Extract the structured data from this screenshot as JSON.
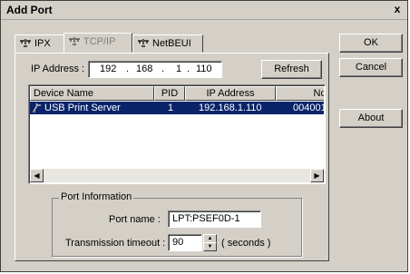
{
  "window": {
    "title": "Add Port",
    "close_glyph": "x"
  },
  "tabs": [
    {
      "label": "IPX",
      "icon": "network-icon"
    },
    {
      "label": "TCP/IP",
      "icon": "network-icon"
    },
    {
      "label": "NetBEUI",
      "icon": "network-icon"
    }
  ],
  "ip": {
    "label": "IP Address :",
    "seg1": "192",
    "seg2": "168",
    "seg3": "1",
    "seg4": "110",
    "dot": "."
  },
  "buttons": {
    "refresh": "Refresh",
    "ok": "OK",
    "cancel": "Cancel",
    "about": "About"
  },
  "list": {
    "columns": [
      "Device Name",
      "PID",
      "IP Address",
      "Nc"
    ],
    "rows": [
      {
        "name": "USB Print Server",
        "pid": "1",
        "ip": "192.168.1.110",
        "extra": "004001"
      }
    ],
    "scroll_left": "◀",
    "scroll_right": "▶"
  },
  "port_info": {
    "group_label": "Port Information",
    "port_name_label": "Port name :",
    "port_name_value": "LPT:PSEF0D-1",
    "timeout_label": "Transmission timeout :",
    "timeout_value": "90",
    "timeout_units": "( seconds )"
  },
  "colors": {
    "selection": "#0a246a",
    "face": "#d4d0c8"
  }
}
